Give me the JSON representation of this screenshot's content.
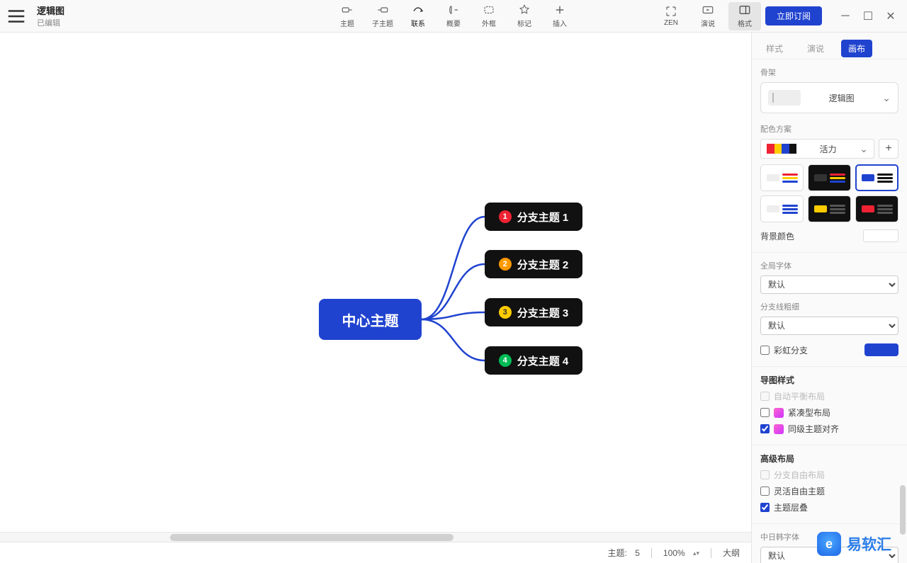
{
  "doc": {
    "title": "逻辑图",
    "status": "已编辑"
  },
  "toolbar": {
    "items": [
      {
        "key": "topic",
        "label": "主题"
      },
      {
        "key": "subtopic",
        "label": "子主题"
      },
      {
        "key": "relationship",
        "label": "联系"
      },
      {
        "key": "summary",
        "label": "概要"
      },
      {
        "key": "boundary",
        "label": "外框"
      },
      {
        "key": "marker",
        "label": "标记"
      },
      {
        "key": "insert",
        "label": "插入"
      }
    ],
    "right": [
      {
        "key": "zen",
        "label": "ZEN"
      },
      {
        "key": "pitch",
        "label": "演说"
      },
      {
        "key": "format",
        "label": "格式",
        "active": true
      }
    ],
    "subscribe": "立即订阅"
  },
  "mindmap": {
    "central": "中心主题",
    "branches": [
      {
        "num": "1",
        "label": "分支主题 1"
      },
      {
        "num": "2",
        "label": "分支主题 2"
      },
      {
        "num": "3",
        "label": "分支主题 3"
      },
      {
        "num": "4",
        "label": "分支主题 4"
      }
    ]
  },
  "status": {
    "topics_label": "主题:",
    "topics_count": "5",
    "zoom": "100%",
    "outline": "大纲"
  },
  "panel": {
    "tabs": {
      "style": "样式",
      "pitch": "演说",
      "canvas": "画布"
    },
    "skeleton": {
      "title": "骨架",
      "value": "逻辑图"
    },
    "colorScheme": {
      "title": "配色方案",
      "value": "活力"
    },
    "bgColor": {
      "title": "背景颜色"
    },
    "globalFont": {
      "title": "全局字体",
      "value": "默认"
    },
    "branchWidth": {
      "title": "分支线粗细",
      "value": "默认"
    },
    "rainbow": {
      "label": "彩虹分支"
    },
    "styleSection": {
      "title": "导图样式",
      "autoBalance": "自动平衡布局",
      "compact": "紧凑型布局",
      "align": "同级主题对齐"
    },
    "advanced": {
      "title": "高级布局",
      "freeBranch": "分支自由布局",
      "freeTopic": "灵活自由主题",
      "overlap": "主题层叠"
    },
    "cjkFont": {
      "title": "中日韩字体",
      "value": "默认"
    }
  },
  "watermark": "易软汇"
}
